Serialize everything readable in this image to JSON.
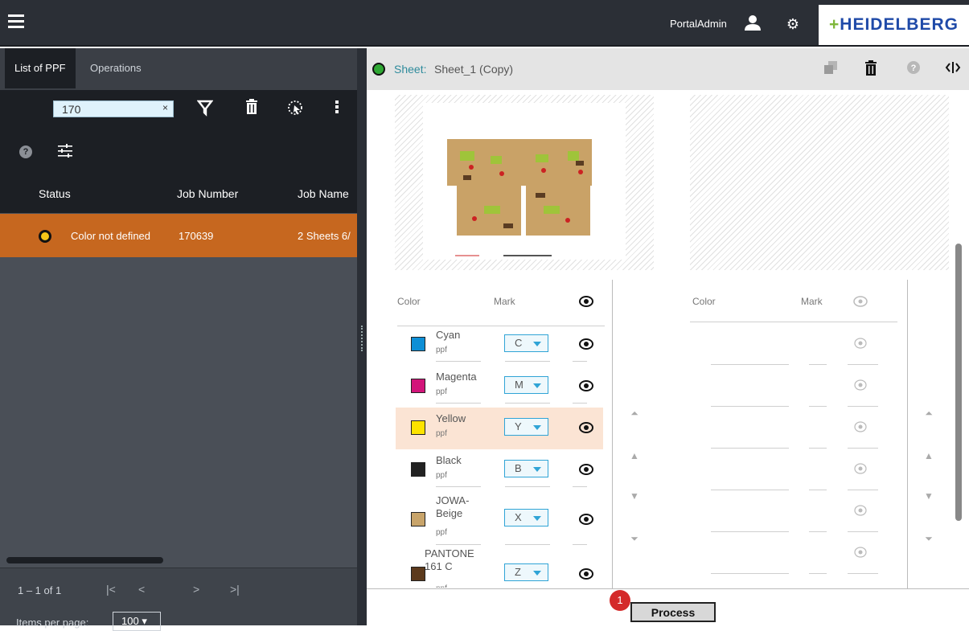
{
  "header": {
    "user": "PortalAdmin",
    "brand": "HEIDELBERG"
  },
  "left": {
    "tabs": [
      "List of PPF",
      "Operations"
    ],
    "search_value": "170",
    "search_clear": "×",
    "table": {
      "headers": [
        "Status",
        "Job Number",
        "Job Name"
      ],
      "rows": [
        {
          "status": "Color not defined",
          "job_number": "170639",
          "job_name": "2 Sheets 6/"
        }
      ]
    },
    "pager": {
      "range": "1 – 1 of 1",
      "first": "|<",
      "prev": "<",
      "next": ">",
      "last": ">|",
      "items_per_page_label": "Items per page:",
      "items_per_page": "100"
    }
  },
  "sheet": {
    "status_color": "#2fa834",
    "label": "Sheet:",
    "name": "Sheet_1 (Copy)"
  },
  "colors_left": {
    "col_color": "Color",
    "col_mark": "Mark",
    "rows": [
      {
        "name": "Cyan",
        "sub": "ppf",
        "mark": "C",
        "swatch": "#0e8fd6"
      },
      {
        "name": "Magenta",
        "sub": "ppf",
        "mark": "M",
        "swatch": "#d2157a"
      },
      {
        "name": "Yellow",
        "sub": "ppf",
        "mark": "Y",
        "swatch": "#fde300"
      },
      {
        "name": "Black",
        "sub": "ppf",
        "mark": "B",
        "swatch": "#222222"
      },
      {
        "name": "JOWA-\nBeige",
        "sub": "ppf",
        "mark": "X",
        "swatch": "#c8a46a"
      },
      {
        "name": "PANTONE\n161 C",
        "sub": "ppf",
        "mark": "Z",
        "swatch": "#5c3a1c"
      }
    ]
  },
  "colors_right": {
    "col_color": "Color",
    "col_mark": "Mark"
  },
  "footer": {
    "process_label": "Process",
    "badge": "1"
  }
}
